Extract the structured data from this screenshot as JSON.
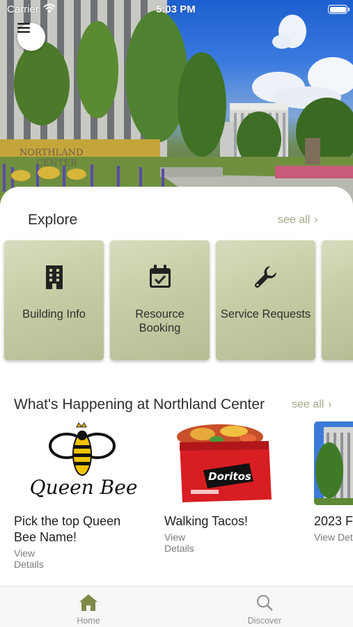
{
  "status_bar": {
    "carrier": "Carrier",
    "time": "5:03 PM"
  },
  "hero": {
    "sign_line1": "NORTHLAND",
    "sign_line2": "CENTER"
  },
  "explore": {
    "title": "Explore",
    "see_all": "see all",
    "cards": [
      {
        "label": "Building Info",
        "icon": "building-icon"
      },
      {
        "label": "Resource Booking",
        "icon": "calendar-check-icon"
      },
      {
        "label": "Service Requests",
        "icon": "wrench-icon"
      }
    ]
  },
  "happening": {
    "title": "What's Happening at Northland Center",
    "see_all": "see all",
    "events": [
      {
        "title": "Pick the top Queen Bee Name!",
        "details": "View Details",
        "logo_text": "Queen Bee"
      },
      {
        "title": "Walking Tacos!",
        "details": "View Details",
        "bag_text": "Doritos"
      },
      {
        "title": "2023 F",
        "details": "View Det"
      }
    ]
  },
  "tabbar": {
    "tabs": [
      {
        "label": "Home",
        "icon": "home-icon",
        "selected": true
      },
      {
        "label": "Discover",
        "icon": "search-icon",
        "selected": false
      }
    ]
  },
  "colors": {
    "accent_olive": "#7f8a4a",
    "card_bg": "#c5cba3",
    "see_all": "#a6a88a",
    "tab_inactive": "#8e8e8e"
  }
}
